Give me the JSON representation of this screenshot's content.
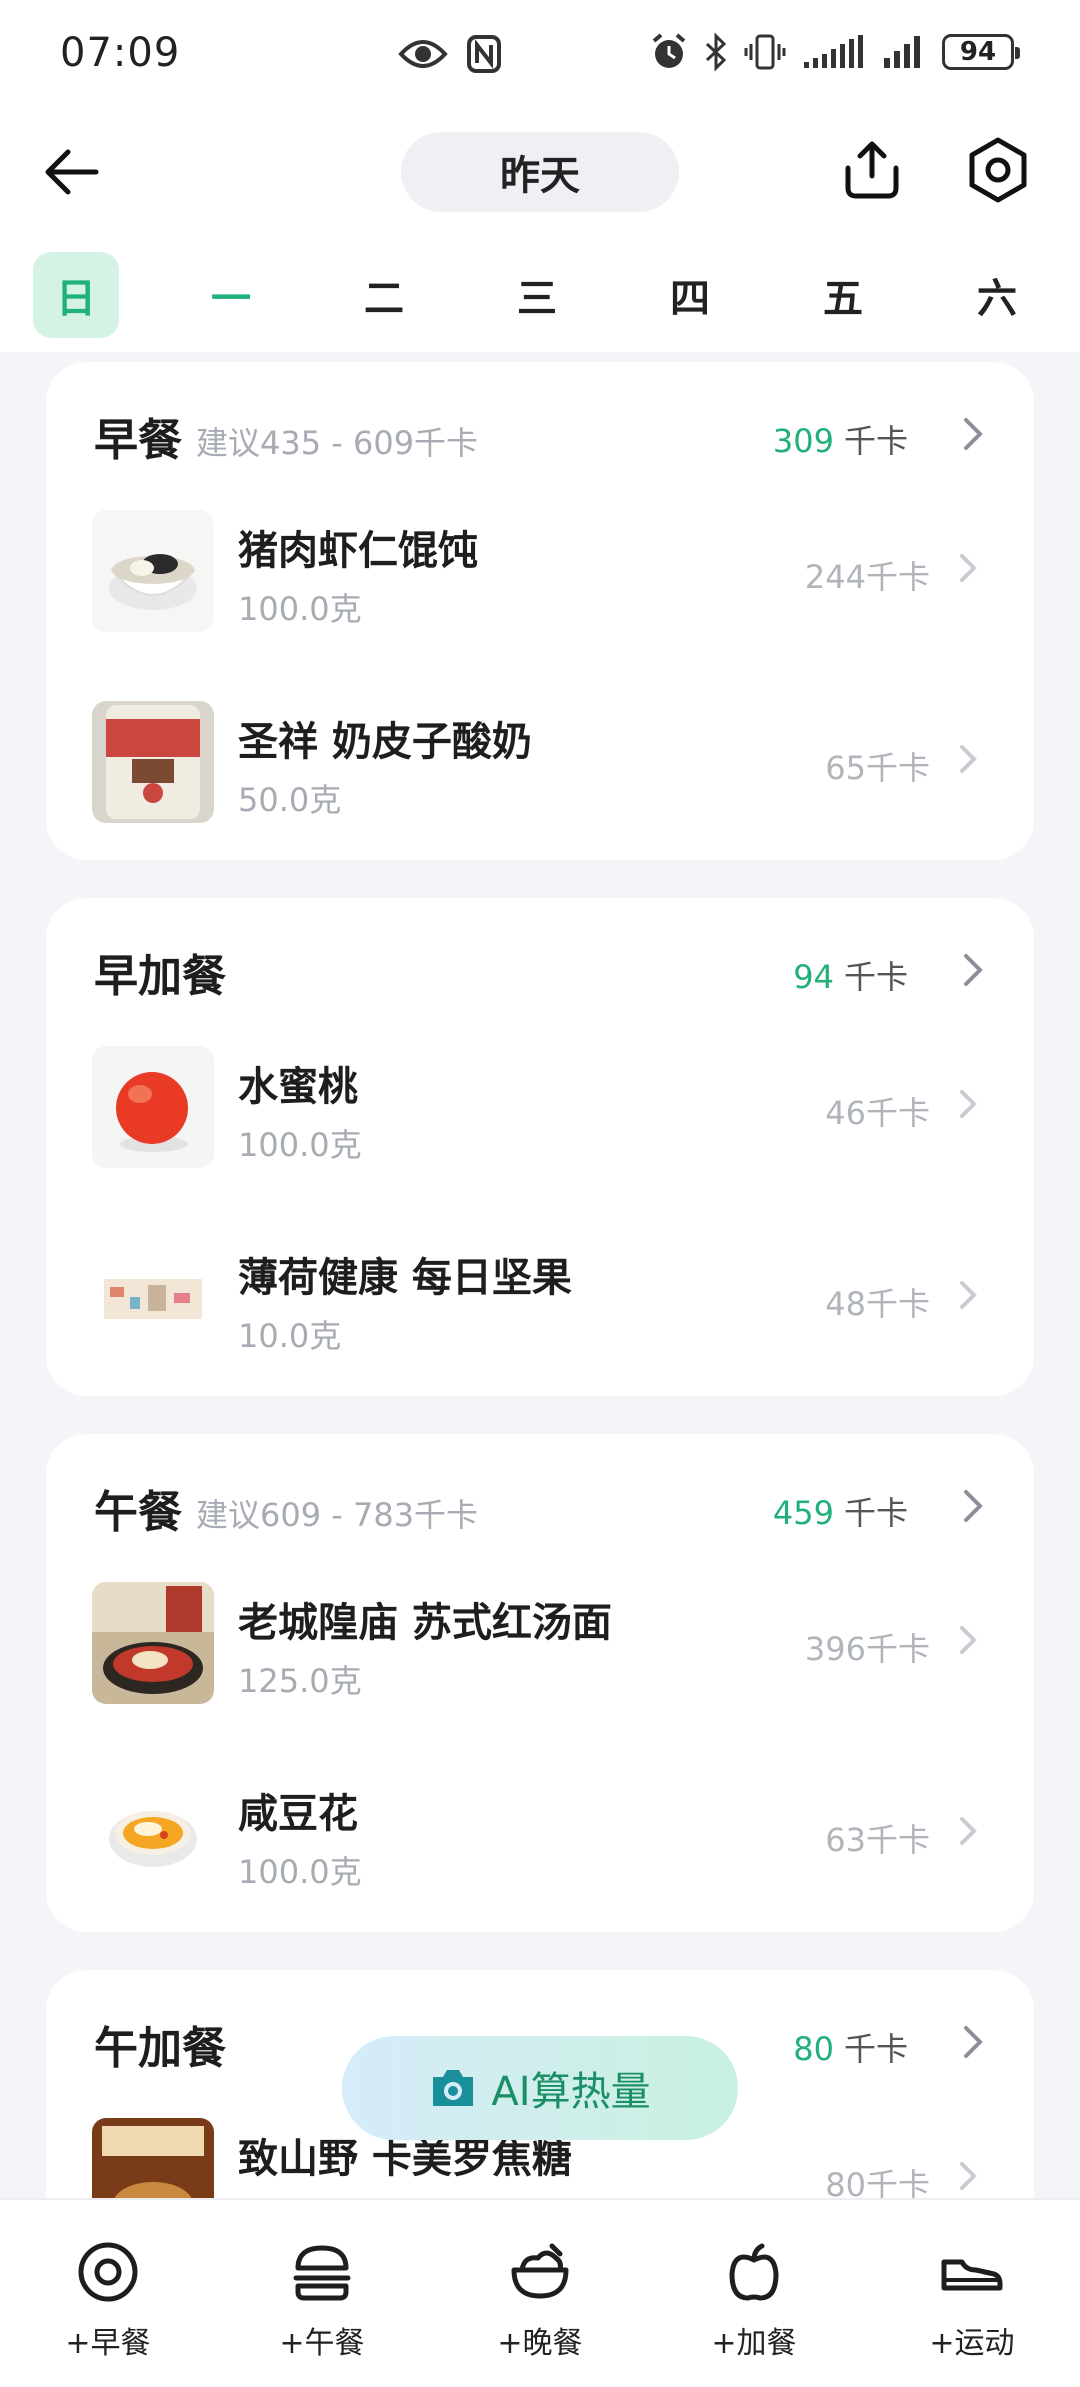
{
  "status": {
    "time": "07:09",
    "battery": "94"
  },
  "header": {
    "date_label": "昨天"
  },
  "weekdays": [
    {
      "label": "日",
      "state": "selected"
    },
    {
      "label": "一",
      "state": "highlight"
    },
    {
      "label": "二",
      "state": "normal"
    },
    {
      "label": "三",
      "state": "normal"
    },
    {
      "label": "四",
      "state": "normal"
    },
    {
      "label": "五",
      "state": "normal"
    },
    {
      "label": "六",
      "state": "normal"
    }
  ],
  "meals": [
    {
      "title": "早餐",
      "suggest": "建议435 - 609千卡",
      "kcal": "309",
      "unit": "千卡",
      "items": [
        {
          "name": "猪肉虾仁馄饨",
          "qty": "100.0克",
          "kcal": "244千卡"
        },
        {
          "name": "圣祥 奶皮子酸奶",
          "qty": "50.0克",
          "kcal": "65千卡"
        }
      ]
    },
    {
      "title": "早加餐",
      "suggest": "",
      "kcal": "94",
      "unit": "千卡",
      "items": [
        {
          "name": "水蜜桃",
          "qty": "100.0克",
          "kcal": "46千卡"
        },
        {
          "name": "薄荷健康 每日坚果",
          "qty": "10.0克",
          "kcal": "48千卡"
        }
      ]
    },
    {
      "title": "午餐",
      "suggest": "建议609 - 783千卡",
      "kcal": "459",
      "unit": "千卡",
      "items": [
        {
          "name": "老城隍庙 苏式红汤面",
          "qty": "125.0克",
          "kcal": "396千卡"
        },
        {
          "name": "咸豆花",
          "qty": "100.0克",
          "kcal": "63千卡"
        }
      ]
    },
    {
      "title": "午加餐",
      "suggest": "",
      "kcal": "80",
      "unit": "千卡",
      "items": [
        {
          "name": "致山野 卡美罗焦糖",
          "qty": "",
          "kcal": "80千卡"
        }
      ]
    }
  ],
  "ai_button": {
    "label": "AI算热量",
    "icon": "camera-icon"
  },
  "bottom_tabs": [
    {
      "label": "+早餐",
      "icon": "egg-icon"
    },
    {
      "label": "+午餐",
      "icon": "burger-icon"
    },
    {
      "label": "+晚餐",
      "icon": "rice-bowl-icon"
    },
    {
      "label": "+加餐",
      "icon": "apple-icon"
    },
    {
      "label": "+运动",
      "icon": "sneaker-icon"
    }
  ],
  "colors": {
    "accent": "#22b07a",
    "background": "#f3f5f8",
    "muted": "#a7abb3"
  }
}
